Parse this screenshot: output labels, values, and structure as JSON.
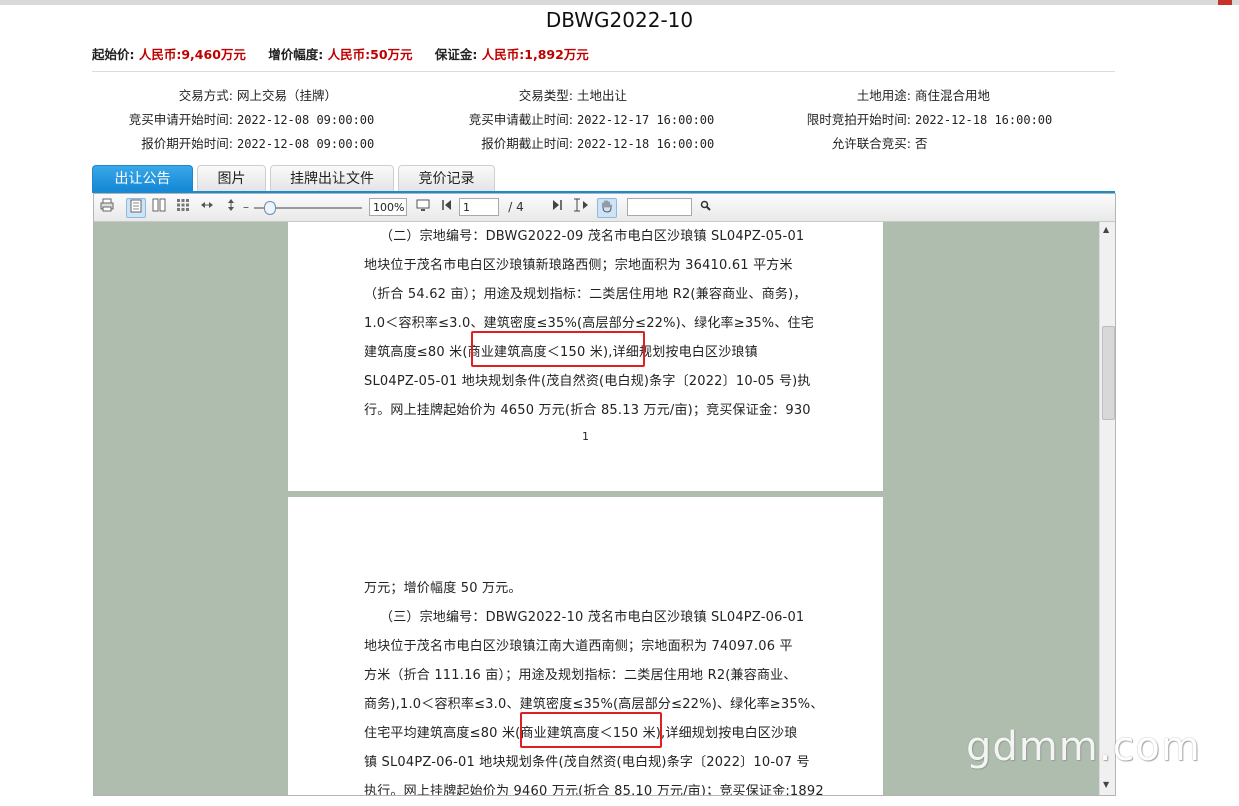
{
  "title": "DBWG2022-10",
  "prices": {
    "start_label": "起始价:",
    "start_value": "人民币:9,460万元",
    "increment_label": "增价幅度:",
    "increment_value": "人民币:50万元",
    "deposit_label": "保证金:",
    "deposit_value": "人民币:1,892万元"
  },
  "info": {
    "trade_method_label": "交易方式:",
    "trade_method_value": "网上交易（挂牌）",
    "trade_type_label": "交易类型:",
    "trade_type_value": "土地出让",
    "land_use_label": "土地用途:",
    "land_use_value": "商住混合用地",
    "apply_start_label": "竞买申请开始时间:",
    "apply_start_value": "2022-12-08 09:00:00",
    "apply_end_label": "竞买申请截止时间:",
    "apply_end_value": "2022-12-17 16:00:00",
    "auction_start_label": "限时竞拍开始时间:",
    "auction_start_value": "2022-12-18 16:00:00",
    "quote_start_label": "报价期开始时间:",
    "quote_start_value": "2022-12-08 09:00:00",
    "quote_end_label": "报价期截止时间:",
    "quote_end_value": "2022-12-18 16:00:00",
    "joint_label": "允许联合竞买:",
    "joint_value": "否"
  },
  "tabs": [
    {
      "label": "出让公告",
      "active": true
    },
    {
      "label": "图片",
      "active": false
    },
    {
      "label": "挂牌出让文件",
      "active": false
    },
    {
      "label": "竞价记录",
      "active": false
    }
  ],
  "viewer": {
    "zoom": "100%",
    "page_current": "1",
    "page_total": "/ 4",
    "search_value": ""
  },
  "page1": {
    "lines": [
      "（二）宗地编号：DBWG2022-09 茂名市电白区沙琅镇 SL04PZ-05-01",
      "地块位于茂名市电白区沙琅镇新琅路西侧；宗地面积为 36410.61 平方米",
      "（折合 54.62 亩）；用途及规划指标：二类居住用地 R2(兼容商业、商务)，",
      "1.0＜容积率≤3.0、建筑密度≤35%(高层部分≤22%)、绿化率≥35%、住宅",
      "建筑高度≤80 米(商业建筑高度＜150 米),详细规划按电白区沙琅镇",
      "SL04PZ-05-01 地块规划条件(茂自然资(电白规)条字〔2022〕10-05 号)执",
      "行。网上挂牌起始价为 4650 万元(折合 85.13 万元/亩)；竞买保证金：930"
    ],
    "page_number": "1"
  },
  "page2": {
    "lines": [
      "万元；增价幅度 50 万元。",
      "（三）宗地编号：DBWG2022-10 茂名市电白区沙琅镇 SL04PZ-06-01",
      "地块位于茂名市电白区沙琅镇江南大道西南侧；宗地面积为 74097.06 平",
      "方米（折合 111.16 亩）；用途及规划指标：二类居住用地 R2(兼容商业、",
      "商务),1.0＜容积率≤3.0、建筑密度≤35%(高层部分≤22%)、绿化率≥35%、",
      "住宅平均建筑高度≤80 米(商业建筑高度＜150 米),详细规划按电白区沙琅",
      "镇 SL04PZ-06-01 地块规划条件(茂自然资(电白规)条字〔2022〕10-07 号",
      "执行。网上挂牌起始价为 9460 万元(折合 85.10 万元/亩)；竞买保证金:1892"
    ]
  },
  "watermark": "gdmm.com",
  "colors": {
    "accent": "#1a8ad4",
    "price_red": "#c00000",
    "highlight_box": "#e02020",
    "doc_bg": "#aebdad"
  }
}
